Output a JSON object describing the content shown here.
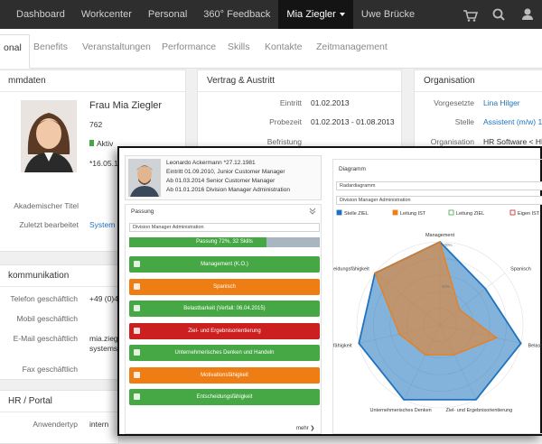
{
  "nav": {
    "items": [
      "Dashboard",
      "Workcenter",
      "Personal",
      "360° Feedback",
      "Mia Ziegler",
      "Uwe Brücke"
    ],
    "cart_count": "0",
    "icons": [
      "cart-icon",
      "search-icon",
      "user-icon"
    ]
  },
  "tabs": [
    "onal",
    "Benefits",
    "Veranstaltungen",
    "Performance",
    "Skills",
    "Kontakte",
    "Zeitmanagement"
  ],
  "stammdaten": {
    "title": "mmdaten",
    "name": "Frau Mia Ziegler",
    "number": "762",
    "status": "Aktiv",
    "date": "*16.05.1",
    "akad_label": "Akademischer Titel",
    "edit_label": "Zuletzt bearbeitet",
    "edit_value": "System"
  },
  "vertrag": {
    "title": "Vertrag & Austritt",
    "rows": [
      {
        "label": "Eintritt",
        "value": "01.02.2013"
      },
      {
        "label": "Probezeit",
        "value": "01.02.2013 - 01.08.2013"
      },
      {
        "label": "Befristung",
        "value": ""
      }
    ]
  },
  "organisation": {
    "title": "Organisation",
    "rows": [
      {
        "label": "Vorgesetzte",
        "value": "Lina Hilger"
      },
      {
        "label": "Stelle",
        "value": "Assistent (m/w) 10"
      },
      {
        "label": "Organisation",
        "value": "HR Software < HR"
      }
    ]
  },
  "kommunikation": {
    "title": "kommunikation",
    "rows": [
      {
        "label": "Telefon geschäftlich",
        "value": "+49 (0)4"
      },
      {
        "label": "Mobil geschäftlich",
        "value": ""
      },
      {
        "label": "E-Mail geschäftlich",
        "value": "mia.ziegl"
      },
      {
        "label": "",
        "value": "systems."
      },
      {
        "label": "Fax geschäftlich",
        "value": ""
      }
    ]
  },
  "hrportal": {
    "title": "HR / Portal",
    "rows": [
      {
        "label": "Anwendertyp",
        "value": "intern"
      }
    ]
  },
  "overlay": {
    "profile_lines": [
      "Leonardo Ackermann *27.12.1981",
      "Eintritt 01.09.2010, Junior Customer Manager",
      "Ab 01.03.2014 Senior Customer Manager",
      "Ab 01.01.2016 Division Manager Administration"
    ],
    "passung_title": "Passung",
    "select_value": "Division Manager Administration",
    "progress_label": "Passung 72%, 32 Skills",
    "progress_pct": 72,
    "skills": [
      {
        "label": "Management (K.O.)",
        "status": "good"
      },
      {
        "label": "Spanisch",
        "status": "warn"
      },
      {
        "label": "Belastbarkeit (Verfall: 06.04.2015)",
        "status": "good"
      },
      {
        "label": "Ziel- und Ergebnisorientierung",
        "status": "bad"
      },
      {
        "label": "Unternehmerisches Denken und Handeln",
        "status": "good"
      },
      {
        "label": "Motivationsfähigkeit",
        "status": "warn"
      },
      {
        "label": "Entscheidungsfähigkeit",
        "status": "good"
      }
    ],
    "more_label": "mehr",
    "diagram_title": "Diagramm",
    "select_chart_type": "Radardiagramm",
    "select_chart_position": "Division Manager Administration"
  },
  "colors": {
    "good": "#45a845",
    "warn": "#ee7d14",
    "bad": "#cc1f1f",
    "stelle": "#1e73be",
    "leitung": "#ee7d14",
    "leitung_ziel": "#45a845",
    "eigen": "#cc1f1f"
  },
  "chart_data": {
    "type": "radar",
    "legend": [
      "Stelle ZIEL",
      "Leitung IST",
      "Leitung ZIEL",
      "Eigen IST"
    ],
    "categories": [
      "Management",
      "Spanisch",
      "Belastbarkeit",
      "Ziel- und Ergebnisorientierung",
      "Unternehmerisches Denken",
      "Motivationsfähigkeit",
      "Entscheidungsfähigkeit"
    ],
    "scale_labels": [
      "100%",
      "50%"
    ],
    "series": [
      {
        "name": "Stelle ZIEL",
        "values": [
          100,
          70,
          100,
          100,
          100,
          100,
          100
        ]
      },
      {
        "name": "Leitung IST",
        "values": [
          100,
          30,
          70,
          40,
          40,
          50,
          100
        ]
      }
    ]
  }
}
